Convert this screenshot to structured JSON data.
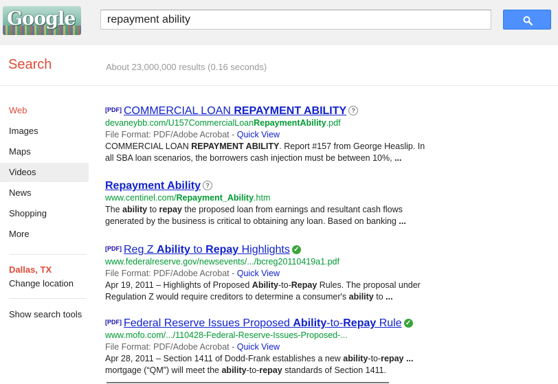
{
  "header": {
    "logo_text": "Google",
    "search_value": "repayment ability",
    "search_button_icon": "search-icon"
  },
  "subheader": {
    "section_label": "Search",
    "result_stats": "About 23,000,000 results (0.16 seconds)"
  },
  "nav": {
    "items": [
      "Web",
      "Images",
      "Maps",
      "Videos",
      "News",
      "Shopping",
      "More"
    ],
    "active": "Web",
    "location_city": "Dallas, TX",
    "change_location": "Change location",
    "show_tools": "Show search tools"
  },
  "results": [
    {
      "tag": "[PDF]",
      "title_html": "COMMERCIAL LOAN <b>REPAYMENT ABILITY</b>",
      "title_text": "COMMERCIAL LOAN REPAYMENT ABILITY",
      "icon": "question-icon",
      "url_html": "devaneybb.com/U157CommercialLoan<b>RepaymentAbility</b>.pdf",
      "url_text": "devaneybb.com/U157CommercialLoanRepaymentAbility.pdf",
      "file_format": "File Format: PDF/Adobe Acrobat - ",
      "quick_view": "Quick View",
      "snippet1_html": "COMMERCIAL LOAN <b>REPAYMENT ABILITY</b>. Report #157 from George Heaslip. In",
      "snippet2_html": "all SBA loan scenarios, the borrowers cash injection must be between 10%, <b>...</b>"
    },
    {
      "tag": "",
      "title_html": "<b>Repayment Ability</b>",
      "title_text": "Repayment Ability",
      "icon": "question-icon",
      "url_html": "www.centinel.com/<b>Repayment_Ability</b>.htm",
      "url_text": "www.centinel.com/Repayment_Ability.htm",
      "snippet1_html": "The <b>ability</b> to <b>repay</b> the proposed loan from earnings and resultant cash flows",
      "snippet2_html": "generated by the business is critical to obtaining any loan. Based on banking <b>...</b>"
    },
    {
      "tag": "[PDF]",
      "title_html": "Reg Z <b>Ability</b> to <b>Repay</b> Highlights",
      "title_text": "Reg Z Ability to Repay Highlights",
      "icon": "verified-check-icon",
      "url_html": "www.federalreserve.gov/newsevents/.../bcreg20110419a1.pdf",
      "url_text": "www.federalreserve.gov/newsevents/.../bcreg20110419a1.pdf",
      "file_format": "File Format: PDF/Adobe Acrobat - ",
      "quick_view": "Quick View",
      "snippet1_html": "Apr 19, 2011 – Highlights of Proposed <b>Ability</b>-to-<b>Repay</b> Rules. The proposal under",
      "snippet2_html": "Regulation Z would require creditors to determine a consumer's <b>ability</b> to <b>...</b>"
    },
    {
      "tag": "[PDF]",
      "title_html": "Federal Reserve Issues Proposed <b>Ability</b>-to-<b>Repay</b> Rule",
      "title_text": "Federal Reserve Issues Proposed Ability-to-Repay Rule",
      "icon": "verified-check-icon",
      "url_html": "www.mofo.com/.../110428-Federal-Reserve-Issues-Proposed-...",
      "url_text": "www.mofo.com/.../110428-Federal-Reserve-Issues-Proposed-...",
      "file_format": "File Format: PDF/Adobe Acrobat - ",
      "quick_view": "Quick View",
      "snippet1_html": "Apr 28, 2011 – Section 1411 of Dodd-Frank establishes a new <b>ability</b>-to-<b>repay</b> <b>...</b>",
      "snippet2_html": "mortgage (“QM”) will meet the <b>ability</b>-to-<b>repay</b> standards of Section 1411."
    }
  ],
  "colors": {
    "accent_red": "#dd4b39",
    "link_blue": "#1122cc",
    "url_green": "#009933",
    "button_blue": "#4d90fe"
  }
}
